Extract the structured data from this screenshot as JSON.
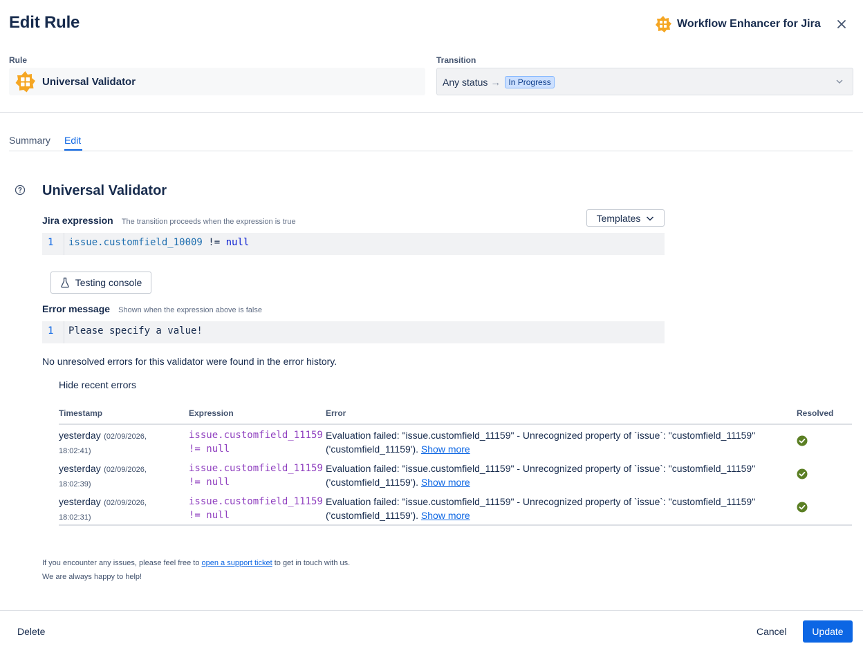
{
  "header": {
    "title": "Edit Rule",
    "app_name": "Workflow Enhancer for Jira",
    "close_icon": "close-icon",
    "app_logo": "app-logo"
  },
  "rule": {
    "label": "Rule",
    "name": "Universal Validator"
  },
  "transition": {
    "label": "Transition",
    "from": "Any status",
    "arrow": "→",
    "to": "In Progress"
  },
  "tabs": [
    {
      "label": "Summary",
      "active": false
    },
    {
      "label": "Edit",
      "active": true
    }
  ],
  "section": {
    "title": "Universal Validator",
    "help_icon": "question-circle-icon"
  },
  "jira_expression": {
    "label": "Jira expression",
    "hint": "The transition proceeds when the expression is true",
    "line_number": "1",
    "code_part1": "issue.customfield_10009",
    "code_part2": " != ",
    "code_part3": "null",
    "templates_label": "Templates"
  },
  "testing_console": {
    "label": "Testing console",
    "icon": "flask-icon"
  },
  "error_message": {
    "label": "Error message",
    "hint": "Shown when the expression above is false",
    "line_number": "1",
    "code": "Please specify a value!"
  },
  "error_history": {
    "no_errors_text": "No unresolved errors for this validator were found in the error history.",
    "toggle_label": "Hide recent errors",
    "columns": [
      "Timestamp",
      "Expression",
      "Error",
      "Resolved"
    ],
    "rows": [
      {
        "ts_main": "yesterday",
        "ts_sub1": "(02/09/2026,",
        "ts_sub2": "18:02:41)",
        "expr1": "issue.customfield_11159",
        "expr2": "!= null",
        "error1": "Evaluation failed: \"issue.customfield_11159\" - Unrecognized property of `issue`: \"customfield_11159\"",
        "error2": "('customfield_11159').",
        "show_more": "Show more",
        "resolved": true
      },
      {
        "ts_main": "yesterday",
        "ts_sub1": "(02/09/2026,",
        "ts_sub2": "18:02:39)",
        "expr1": "issue.customfield_11159",
        "expr2": "!= null",
        "error1": "Evaluation failed: \"issue.customfield_11159\" - Unrecognized property of `issue`: \"customfield_11159\"",
        "error2": "('customfield_11159').",
        "show_more": "Show more",
        "resolved": true
      },
      {
        "ts_main": "yesterday",
        "ts_sub1": "(02/09/2026,",
        "ts_sub2": "18:02:31)",
        "expr1": "issue.customfield_11159",
        "expr2": "!= null",
        "error1": "Evaluation failed: \"issue.customfield_11159\" - Unrecognized property of `issue`: \"customfield_11159\"",
        "error2": "('customfield_11159').",
        "show_more": "Show more",
        "resolved": true
      }
    ]
  },
  "support": {
    "line1_prefix": "If you encounter any issues, please feel free to ",
    "link_text": "open a support ticket",
    "line1_suffix": " to get in touch with us.",
    "line2": "We are always happy to help!"
  },
  "footer": {
    "delete_label": "Delete",
    "cancel_label": "Cancel",
    "update_label": "Update"
  },
  "colors": {
    "accent": "#0c66e4",
    "resolved": "#5b7f24",
    "expression": "#8f3fbf",
    "logo_orange": "#f5a623"
  }
}
